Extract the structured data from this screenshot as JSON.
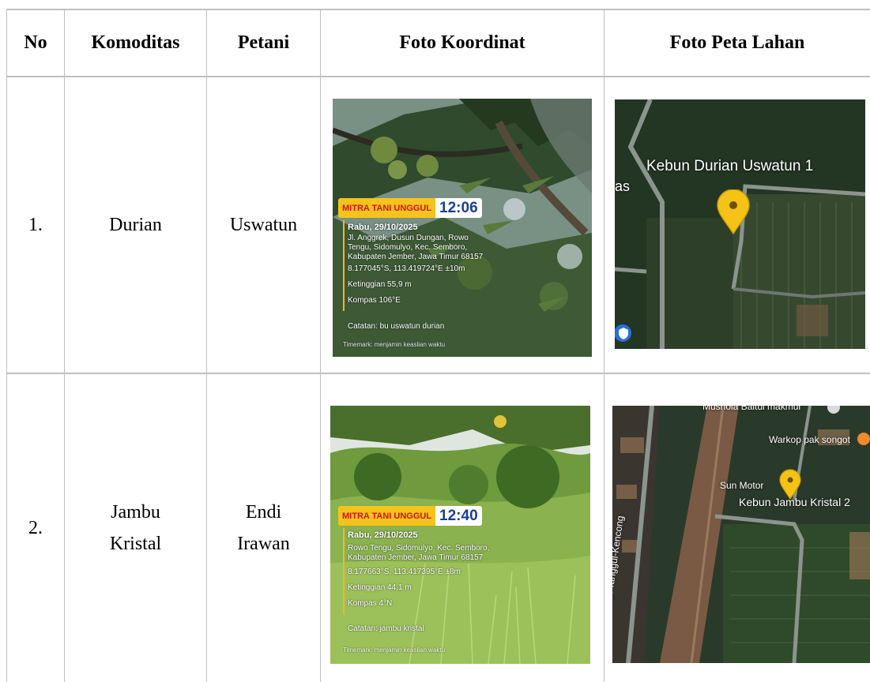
{
  "table": {
    "headers": [
      "No",
      "Komoditas",
      "Petani",
      "Foto Koordinat",
      "Foto Peta Lahan"
    ],
    "rows": [
      {
        "no": "1.",
        "komoditas": "Durian",
        "petani": "Uswatun",
        "foto_koordinat": {
          "brand": "MITRA TANI UNGGUL",
          "time": "12:06",
          "date": "Rabu, 29/10/2025",
          "address_1": "Jl. Anggrek, Dusun Dungan, Rowo",
          "address_2": "Tengu, Sidomulyo, Kec. Semboro,",
          "address_3": "Kabupaten Jember, Jawa Timur 68157",
          "coords": "8.177045°S, 113.419724°E ±10m",
          "altitude": "Ketinggian 55,9 m",
          "compass": "Kompas 106°E",
          "note": "Catatan: bu uswatun durian",
          "footer": "Timemark: menjamin keaslian waktu"
        },
        "foto_peta": {
          "place_label": "Kebun Durian Uswatun 1",
          "edge_label": "as"
        }
      },
      {
        "no": "2.",
        "komoditas": "Jambu Kristal",
        "komoditas_line1": "Jambu",
        "komoditas_line2": "Kristal",
        "petani": "Endi Irawan",
        "petani_line1": "Endi",
        "petani_line2": "Irawan",
        "foto_koordinat": {
          "brand": "MITRA TANI UNGGUL",
          "time": "12:40",
          "date": "Rabu, 29/10/2025",
          "address_1": "Rowo Tengu, Sidomulyo, Kec. Semboro,",
          "address_2": "Kabupaten Jember, Jawa Timur 68157",
          "coords": "8.177663°S, 113.417395°E ±8m",
          "altitude": "Ketinggian 44,1 m",
          "compass": "Kompas 4°N",
          "note": "Catatan: jambu kristal",
          "footer": "Timemark: menjamin keaslian waktu"
        },
        "foto_peta": {
          "top_label": "Mushola Baitul makmur",
          "poi_1": "Warkop pak songot",
          "poi_2": "Sun Motor",
          "place_label": "Kebun Jambu Kristal 2",
          "road_label": "Jl. Tanggul-Kencong"
        }
      }
    ]
  },
  "colors": {
    "grid": "#bfbfbf",
    "badge_bg": "#f6c21c",
    "badge_text": "#c8161d",
    "time_text": "#1a3f8c",
    "pin": "#f4c316"
  },
  "icons": [
    "map-pin-icon",
    "shield-icon"
  ]
}
